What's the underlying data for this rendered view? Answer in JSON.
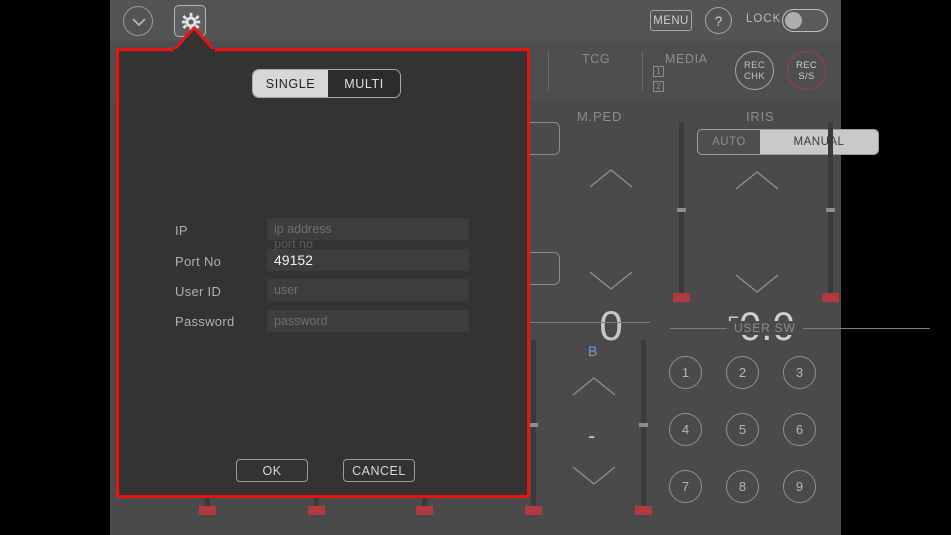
{
  "header": {
    "chevron_icon": "chevron-down-icon",
    "gear_icon": "gear-icon",
    "menu_label": "MENU",
    "help_label": "?",
    "lock_label": "LOCK",
    "lock_state": "off"
  },
  "status_row": {
    "tcg_label": "TCG",
    "media_label": "MEDIA",
    "media_slot1": "1",
    "media_slot2": "2",
    "rec_chk_line1": "REC",
    "rec_chk_line2": "CHK",
    "rec_ss_line1": "REC",
    "rec_ss_line2": "S/S"
  },
  "mped": {
    "title": "M.PED",
    "value": "0",
    "up_icon": "triangle-up-icon",
    "down_icon": "triangle-down-icon"
  },
  "iris": {
    "title": "IRIS",
    "mode_auto": "AUTO",
    "mode_manual": "MANUAL",
    "selected_mode": "MANUAL",
    "prefix": "F",
    "value": "0.0",
    "up_icon": "triangle-up-icon",
    "down_icon": "triangle-down-icon"
  },
  "blue_channel": {
    "label": "B",
    "value": "-",
    "up_icon": "triangle-up-icon",
    "down_icon": "triangle-down-icon"
  },
  "user_sw": {
    "section_label": "USER SW",
    "buttons": [
      "1",
      "2",
      "3",
      "4",
      "5",
      "6",
      "7",
      "8",
      "9"
    ]
  },
  "dialog": {
    "mode_toggle": {
      "single_label": "SINGLE",
      "multi_label": "MULTI",
      "selected": "SINGLE"
    },
    "fields": [
      {
        "label": "IP",
        "value": "",
        "placeholder": "ip address",
        "filled": false
      },
      {
        "label": "Port No",
        "value": "49152",
        "placeholder": "port no",
        "filled": true
      },
      {
        "label": "User ID",
        "value": "",
        "placeholder": "user",
        "filled": false
      },
      {
        "label": "Password",
        "value": "",
        "placeholder": "password",
        "filled": false
      }
    ],
    "ok_label": "OK",
    "cancel_label": "CANCEL"
  },
  "colors": {
    "highlight_border": "#ee1111",
    "accent_red": "#b03a3f",
    "blue_text": "#6f9ed4",
    "dialog_bg": "#333333",
    "app_bg": "#4a4a4a"
  }
}
